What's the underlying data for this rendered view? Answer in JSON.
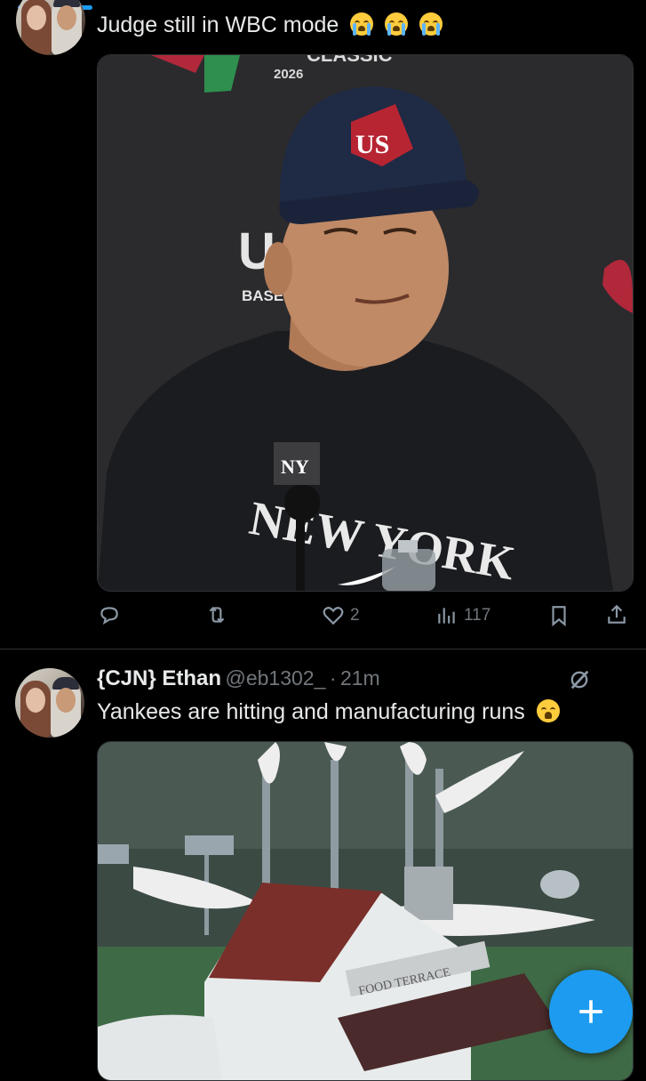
{
  "tweet1": {
    "text": "Judge still in WBC mode",
    "emojis": [
      "loudly-crying-face",
      "loudly-crying-face",
      "loudly-crying-face"
    ],
    "media": {
      "backdrop_text": "CLASSIC",
      "backdrop_year": "2026",
      "backdrop_logo_text": "U",
      "backdrop_sub_text": "BASE",
      "cap_logo": "US",
      "shirt_text": "NEW YORK",
      "mic_logo": "NY"
    },
    "actions": {
      "reply_count": "",
      "retweet_count": "",
      "like_count": "2",
      "views_count": "117"
    }
  },
  "tweet2": {
    "name": "{CJN} Ethan",
    "handle": "@eb1302_",
    "separator": "·",
    "time": "21m",
    "text": "Yankees are hitting and manufacturing runs",
    "emoji": "weary-face",
    "media": {
      "sign_text": "FOOD TERRACE"
    }
  },
  "fab": {
    "label": "+"
  },
  "colors": {
    "background": "#000000",
    "text": "#e7e9ea",
    "secondary": "#71767b",
    "accent": "#1d9bf0",
    "divider": "#2f3336"
  }
}
